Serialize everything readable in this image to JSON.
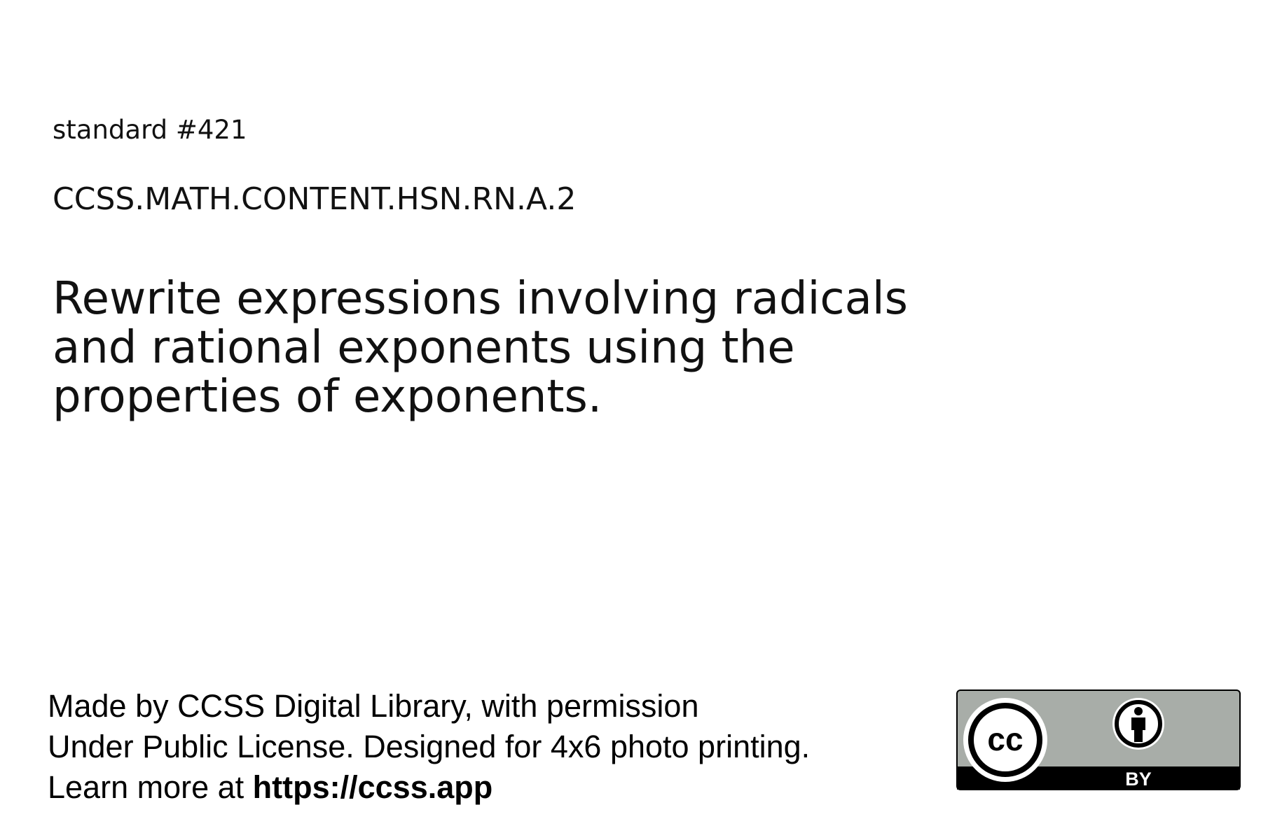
{
  "standard": {
    "number_label": "standard #421",
    "code": "CCSS.MATH.CONTENT.HSN.RN.A.2",
    "text": "Rewrite expressions involving radicals and rational exponents using the properties of exponents."
  },
  "footer": {
    "line1": "Made by CCSS Digital Library, with permission",
    "line2": "Under Public License. Designed for 4x6 photo printing.",
    "line3_prefix": "Learn more at ",
    "line3_url": "https://ccss.app"
  },
  "license_badge": {
    "cc_text": "cc",
    "by_text": "BY",
    "icons": [
      "creative-commons-icon",
      "attribution-person-icon"
    ],
    "colors": {
      "badge_gray": "#a8ada8",
      "badge_black": "#000000",
      "badge_white": "#ffffff"
    }
  }
}
